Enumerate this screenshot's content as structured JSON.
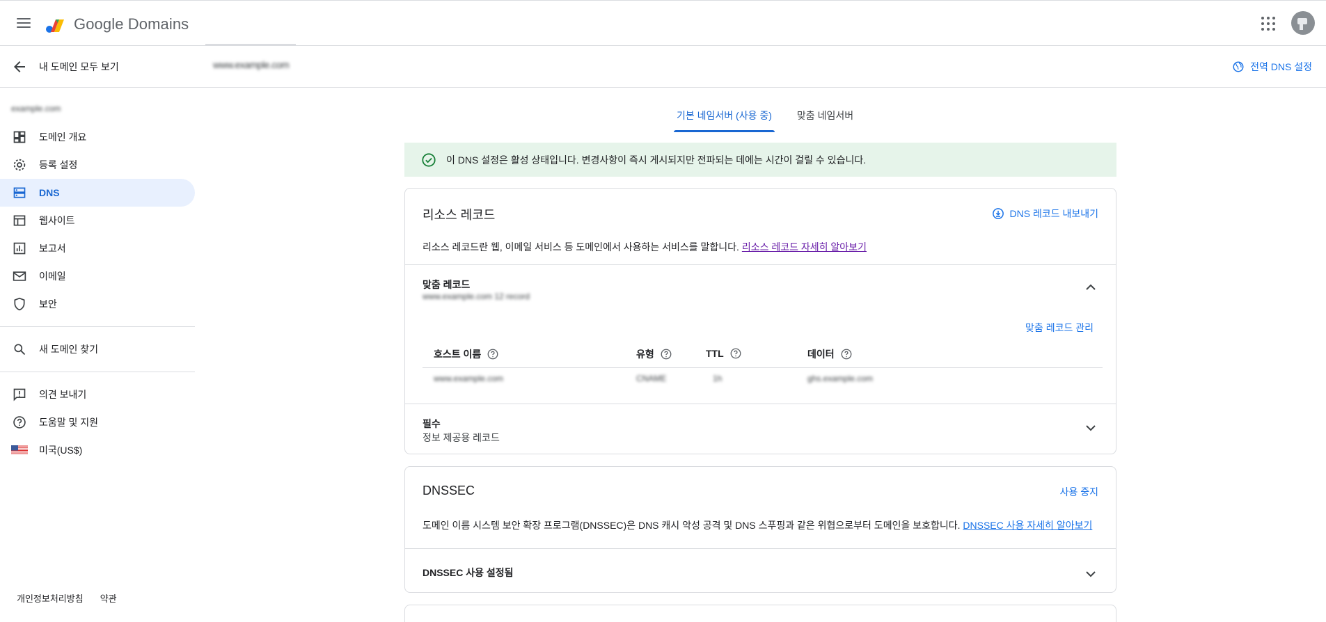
{
  "app": {
    "title": "Google Domains",
    "menu_icon": "hamburger-icon",
    "apps_icon": "apps-grid-icon"
  },
  "subheader": {
    "back_label": "내 도메인 모두 보기",
    "domain_name": "www.example.com",
    "global_dns_label": "전역 DNS 설정"
  },
  "sidebar": {
    "domain_name": "example.com",
    "items": [
      {
        "label": "도메인 개요",
        "icon": "dashboard-icon"
      },
      {
        "label": "등록 설정",
        "icon": "gear-icon"
      },
      {
        "label": "DNS",
        "icon": "dns-icon"
      },
      {
        "label": "웹사이트",
        "icon": "web-icon"
      },
      {
        "label": "보고서",
        "icon": "bar-chart-icon"
      },
      {
        "label": "이메일",
        "icon": "mail-icon"
      },
      {
        "label": "보안",
        "icon": "shield-icon"
      }
    ],
    "find_domain": "새 도메인 찾기",
    "feedback": "의견 보내기",
    "help": "도움말 및 지원",
    "region": "미국(US$)",
    "footer": {
      "privacy": "개인정보처리방침",
      "terms": "약관"
    }
  },
  "tabs": [
    {
      "label": "기본 네임서버 (사용 중)",
      "active": true
    },
    {
      "label": "맞춤 네임서버",
      "active": false
    }
  ],
  "banner": {
    "text": "이 DNS 설정은 활성 상태입니다. 변경사항이 즉시 게시되지만 전파되는 데에는 시간이 걸릴 수 있습니다."
  },
  "resource_records": {
    "title": "리소스 레코드",
    "export_label": "DNS 레코드 내보내기",
    "description": "리소스 레코드란 웹, 이메일 서비스 등 도메인에서 사용하는 서비스를 말합니다.",
    "learn_more": "리소스 레코드 자세히 알아보기",
    "custom": {
      "title": "맞춤 레코드",
      "subtitle": "www.example.com 12 record",
      "manage_label": "맞춤 레코드 관리",
      "columns": [
        "호스트 이름",
        "유형",
        "TTL",
        "데이터"
      ],
      "rows": [
        [
          "www.example.com",
          "CNAME",
          "1h",
          "ghs.example.com"
        ]
      ]
    },
    "required": {
      "title": "필수",
      "subtitle": "정보 제공용 레코드"
    }
  },
  "dnssec": {
    "title": "DNSSEC",
    "action_label": "사용 중지",
    "description": "도메인 이름 시스템 보안 확장 프로그램(DNSSEC)은 DNS 캐시 악성 공격 및 DNS 스푸핑과 같은 위협으로부터 도메인을 보호합니다.",
    "learn_more": "DNSSEC 사용 자세히 알아보기",
    "status": "DNSSEC 사용 설정됨"
  },
  "colors": {
    "accent": "#1a73e8",
    "active_nav_bg": "#e8f0fe",
    "banner_bg": "#e6f4ea",
    "success": "#188038"
  }
}
